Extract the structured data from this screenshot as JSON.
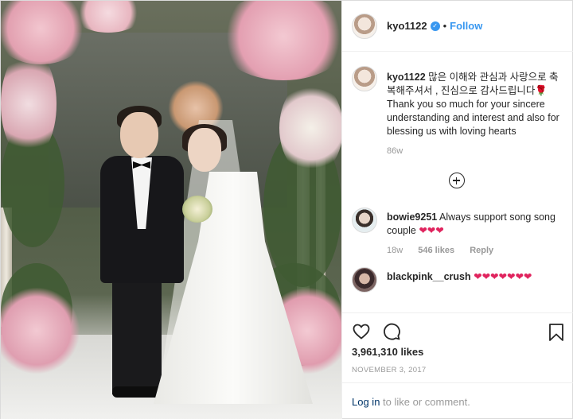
{
  "post": {
    "username": "kyo1122",
    "follow_label": "Follow",
    "dot": "•",
    "verified_glyph": "✓"
  },
  "caption": {
    "username": "kyo1122",
    "text": " 많은 이해와 관심과 사랑으로 축복해주셔서 , 진심으로 감사드립니다🌹 Thank you so much for your sincere understanding and interest and also for blessing us with loving hearts",
    "time": "86w"
  },
  "comments": [
    {
      "username": "bowie9251",
      "text": " Always support song song couple ",
      "hearts": "❤❤❤",
      "time": "18w",
      "likes": "546 likes",
      "reply": "Reply"
    },
    {
      "username": "blackpink__crush",
      "text": " ",
      "hearts": "❤❤❤❤❤❤❤"
    }
  ],
  "engagement": {
    "likes": "3,961,310 likes",
    "date": "November 3, 2017"
  },
  "footer": {
    "login_label": "Log in",
    "suffix": " to like or comment."
  },
  "colors": {
    "accent": "#3897f0",
    "heart": "#e0245e",
    "login_link": "#003569"
  },
  "icons": [
    "heart-icon",
    "comment-icon",
    "bookmark-icon",
    "load-more-icon",
    "verified-badge-icon"
  ]
}
